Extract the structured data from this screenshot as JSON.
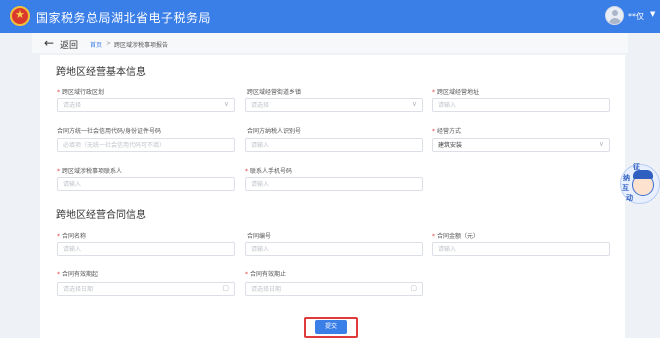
{
  "header": {
    "site_title": "国家税务总局湖北省电子税务局",
    "user_name": "**仅",
    "caret": "▼"
  },
  "subnav": {
    "back_arrow": "←",
    "back_label": "返回",
    "crumb_home": "首页",
    "crumb_sep": ">",
    "crumb_current": "跨区域涉税事项报告"
  },
  "section1": {
    "title": "跨地区经营基本信息",
    "fields": [
      {
        "label": "跨区域行政区划",
        "required": "*",
        "value": "请选择",
        "icon": "∨"
      },
      {
        "label": "跨区域经营街道乡镇",
        "required": "",
        "value": "请选择",
        "icon": "∨"
      },
      {
        "label": "跨区域经营地址",
        "required": "*",
        "value": "请输入",
        "icon": ""
      },
      {
        "label": "合同方纳税人识别号",
        "required": "",
        "value": "请输入",
        "icon": ""
      },
      {
        "label": "经营方式",
        "required": "*",
        "value": "建筑安装",
        "icon": "∨"
      },
      {
        "label": "跨区域涉税事项联系人",
        "required": "*",
        "value": "请输入",
        "icon": ""
      },
      {
        "label": "联系人手机号码",
        "required": "*",
        "value": "请输入",
        "icon": ""
      }
    ],
    "unified_code": {
      "label": "合同方统一社会信用代码/身份证件号码",
      "value": "必填项（无统一社会信用代码可不填）"
    }
  },
  "section2": {
    "title": "跨地区经营合同信息",
    "fields": [
      {
        "label": "合同名称",
        "required": "*",
        "value": "请输入",
        "icon": ""
      },
      {
        "label": "合同编号",
        "required": "",
        "value": "请输入",
        "icon": ""
      },
      {
        "label": "合同金额（元）",
        "required": "*",
        "value": "请输入",
        "icon": ""
      },
      {
        "label": "合同有效期起",
        "required": "*",
        "value": "请选择日期",
        "icon": "▢"
      },
      {
        "label": "合同有效期止",
        "required": "*",
        "value": "请选择日期",
        "icon": "▢"
      }
    ]
  },
  "submit_label": "提交",
  "mascot": {
    "t1": "征",
    "t2": "纳",
    "t3": "互",
    "t4": "动"
  },
  "colors": {
    "brand": "#3a7ee8",
    "highlight": "#e03a3a",
    "required": "#e54545"
  }
}
